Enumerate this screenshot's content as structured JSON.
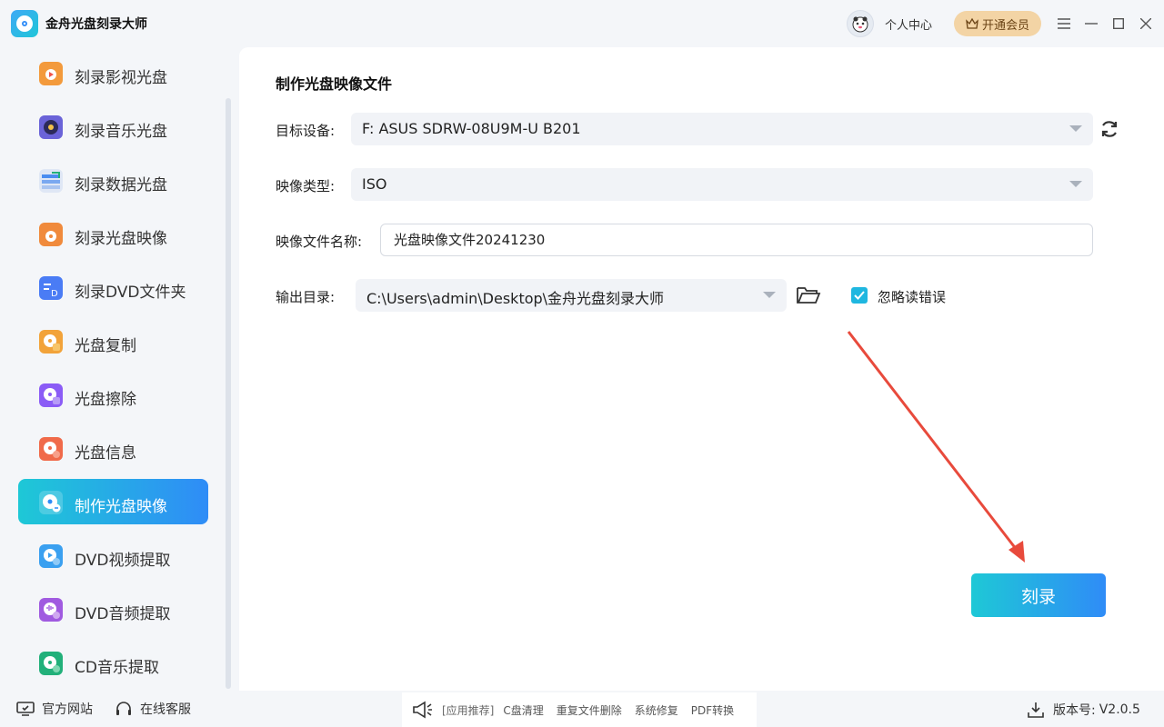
{
  "app": {
    "title": "金舟光盘刻录大师",
    "user_center": "个人中心",
    "vip_label": "开通会员"
  },
  "sidebar": {
    "items": [
      {
        "label": "刻录影视光盘",
        "icon": "video-disc-icon",
        "color": "#f39a3c"
      },
      {
        "label": "刻录音乐光盘",
        "icon": "music-disc-icon",
        "color": "#6a63d8"
      },
      {
        "label": "刻录数据光盘",
        "icon": "data-disc-icon",
        "color": "#4b8df0"
      },
      {
        "label": "刻录光盘映像",
        "icon": "image-disc-icon",
        "color": "#f08a3c"
      },
      {
        "label": "刻录DVD文件夹",
        "icon": "dvd-folder-icon",
        "color": "#4a7cf5"
      },
      {
        "label": "光盘复制",
        "icon": "copy-disc-icon",
        "color": "#f2a33a"
      },
      {
        "label": "光盘擦除",
        "icon": "erase-disc-icon",
        "color": "#8b5cf6"
      },
      {
        "label": "光盘信息",
        "icon": "info-disc-icon",
        "color": "#f06a4a"
      },
      {
        "label": "制作光盘映像",
        "icon": "make-image-icon",
        "color": "#ffffff"
      },
      {
        "label": "DVD视频提取",
        "icon": "dvd-video-extract-icon",
        "color": "#3aa0f0"
      },
      {
        "label": "DVD音频提取",
        "icon": "dvd-audio-extract-icon",
        "color": "#a05ae0"
      },
      {
        "label": "CD音乐提取",
        "icon": "cd-music-extract-icon",
        "color": "#22b07a"
      }
    ],
    "active_index": 8
  },
  "main": {
    "title": "制作光盘映像文件",
    "target_device_label": "目标设备:",
    "target_device_value": "F: ASUS SDRW-08U9M-U B201",
    "image_type_label": "映像类型:",
    "image_type_value": "ISO",
    "file_name_label": "映像文件名称:",
    "file_name_value": "光盘映像文件20241230",
    "output_dir_label": "输出目录:",
    "output_dir_value": "C:\\Users\\admin\\Desktop\\金舟光盘刻录大师",
    "ignore_errors_label": "忽略读错误",
    "ignore_errors_checked": true,
    "burn_button": "刻录"
  },
  "footer": {
    "official_site": "官方网站",
    "online_service": "在线客服",
    "rec_tag": "[应用推荐]",
    "rec_items": [
      "C盘清理",
      "重复文件删除",
      "系统修复",
      "PDF转换"
    ],
    "version_label": "版本号:",
    "version_value": "V2.0.5"
  },
  "colors": {
    "accent_start": "#1ec8d6",
    "accent_end": "#2f8cf7",
    "arrow": "#e84a3c",
    "vip_bg": "#f3d4a5"
  }
}
